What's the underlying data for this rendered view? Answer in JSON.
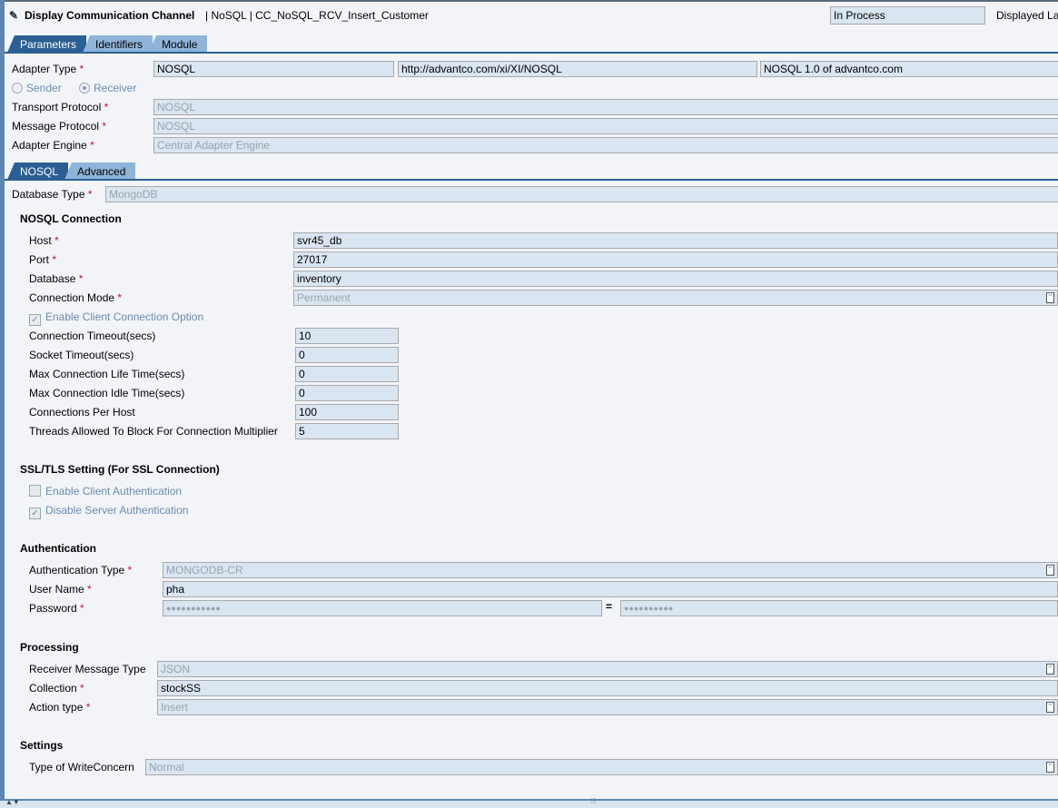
{
  "header": {
    "title": "Display Communication Channel",
    "subtitle": "| NoSQL | CC_NoSQL_RCV_Insert_Customer",
    "status": "In Process",
    "displayed": "Displayed La"
  },
  "tabs": [
    "Parameters",
    "Identifiers",
    "Module"
  ],
  "params": {
    "adapter_type": {
      "label": "Adapter Type",
      "value": "NOSQL",
      "namespace": "http://advantco.com/xi/XI/NOSQL",
      "version": "NOSQL 1.0 of advantco.com"
    },
    "sender": "Sender",
    "receiver": "Receiver",
    "direction": "Receiver",
    "transport": {
      "label": "Transport Protocol",
      "value": "NOSQL"
    },
    "message": {
      "label": "Message Protocol",
      "value": "NOSQL"
    },
    "engine": {
      "label": "Adapter Engine",
      "value": "Central Adapter Engine"
    }
  },
  "subtabs": [
    "NOSQL",
    "Advanced"
  ],
  "db_type": {
    "label": "Database Type",
    "value": "MongoDB"
  },
  "conn": {
    "title": "NOSQL Connection",
    "host": {
      "label": "Host",
      "value": "svr45_db"
    },
    "port": {
      "label": "Port",
      "value": "27017"
    },
    "database": {
      "label": "Database",
      "value": "inventory"
    },
    "mode": {
      "label": "Connection Mode",
      "value": "Permanent"
    },
    "enable_option": {
      "label": "Enable Client Connection Option",
      "checked": true
    },
    "numeric": [
      {
        "label": "Connection Timeout(secs)",
        "value": "10"
      },
      {
        "label": "Socket Timeout(secs)",
        "value": "0"
      },
      {
        "label": "Max Connection Life Time(secs)",
        "value": "0"
      },
      {
        "label": "Max Connection Idle Time(secs)",
        "value": "0"
      },
      {
        "label": "Connections Per Host",
        "value": "100"
      },
      {
        "label": "Threads Allowed To Block For Connection Multiplier",
        "value": "5"
      }
    ]
  },
  "ssl": {
    "title": "SSL/TLS Setting (For SSL Connection)",
    "client_auth": {
      "label": "Enable Client Authentication",
      "checked": false
    },
    "server_auth": {
      "label": "Disable Server Authentication",
      "checked": true
    }
  },
  "auth": {
    "title": "Authentication",
    "type": {
      "label": "Authentication Type",
      "value": "MONGODB-CR"
    },
    "user": {
      "label": "User Name",
      "value": "pha"
    },
    "password": {
      "label": "Password",
      "value": "●●●●●●●●●●●",
      "confirm": "●●●●●●●●●●",
      "equals": "="
    }
  },
  "processing": {
    "title": "Processing",
    "msg_type": {
      "label": "Receiver Message Type",
      "value": "JSON"
    },
    "collection": {
      "label": "Collection",
      "value": "stockSS"
    },
    "action": {
      "label": "Action type",
      "value": "Insert"
    }
  },
  "settings": {
    "title": "Settings",
    "write": {
      "label": "Type of WriteConcern",
      "value": "Normal"
    }
  },
  "req": "*"
}
